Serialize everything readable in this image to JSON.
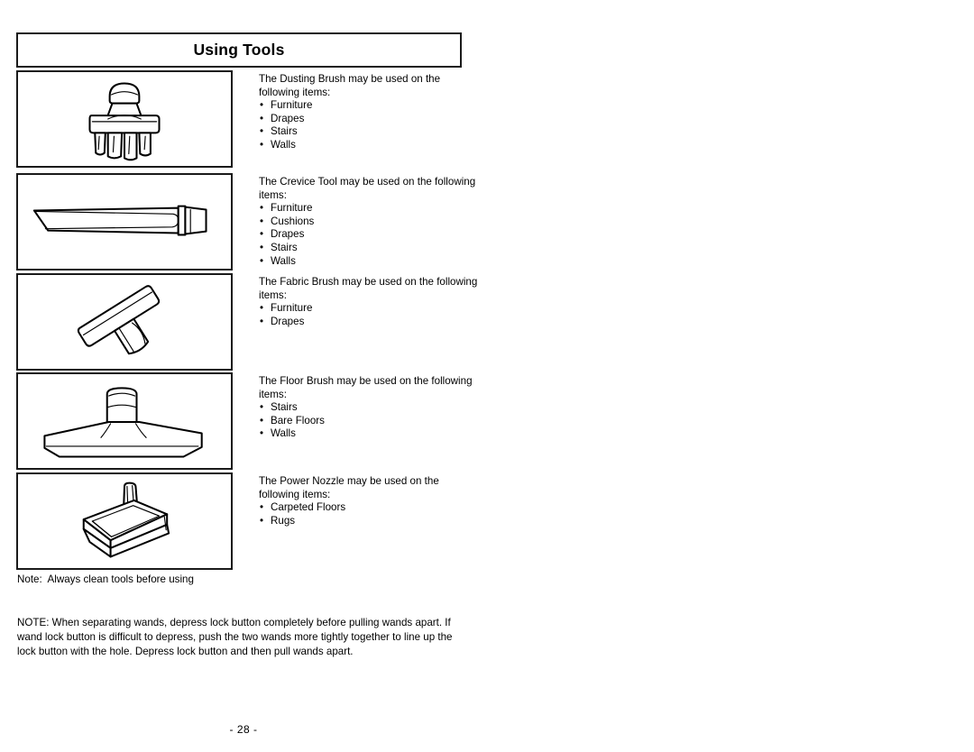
{
  "page": {
    "title": "Using Tools",
    "page_number": "- 28 -"
  },
  "tools": [
    {
      "icon": "dusting-brush-illustration",
      "lead": "The Dusting Brush may be used on the following items:",
      "items": [
        "Furniture",
        "Drapes",
        "Stairs",
        "Walls"
      ],
      "bullet": "•"
    },
    {
      "icon": "crevice-tool-illustration",
      "lead": "The Crevice Tool may be used on the following items:",
      "items": [
        "Furniture",
        "Cushions",
        "Drapes",
        "Stairs",
        "Walls"
      ],
      "bullet": "•"
    },
    {
      "icon": "fabric-brush-illustration",
      "lead": "The Fabric Brush may be used on the following items:",
      "items": [
        "Furniture",
        "Drapes"
      ],
      "bullet": "•"
    },
    {
      "icon": "floor-brush-illustration",
      "lead": "The Floor Brush may be used on the following items:",
      "items": [
        "Stairs",
        "Bare Floors",
        "Walls"
      ],
      "bullet": "•"
    },
    {
      "icon": "power-nozzle-illustration",
      "lead": "The Power Nozzle may be used on the following items:",
      "items": [
        "Carpeted Floors",
        "Rugs"
      ],
      "bullet": "•"
    }
  ],
  "note_line": "Note:  Always clean tools before using",
  "note_block": "NOTE: When separating wands, depress lock button completely before pulling wands apart. If wand lock button is difficult to depress, push the two wands more tightly together to line up the lock button with the hole. Depress lock button and then pull wands apart."
}
